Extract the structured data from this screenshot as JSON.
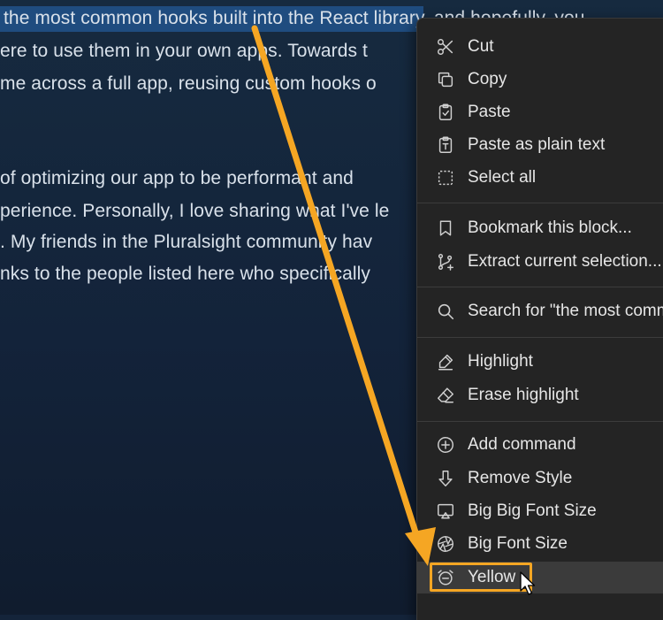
{
  "document": {
    "lines": [
      " the most common hooks built into the React library, and hopefully, you",
      "ere to use them in your own apps. Towards t",
      "me across a full app, reusing custom hooks o",
      "of optimizing our app to be performant and",
      "perience. Personally, I love sharing what I've le",
      ". My friends in the Pluralsight community hav",
      "nks to the people listed here who specifically"
    ],
    "highlighted_text": " the most common hooks built into the React library"
  },
  "context_menu": {
    "items": [
      {
        "label": "Cut",
        "icon": "scissors-icon"
      },
      {
        "label": "Copy",
        "icon": "copy-icon"
      },
      {
        "label": "Paste",
        "icon": "clipboard-check-icon"
      },
      {
        "label": "Paste as plain text",
        "icon": "clipboard-text-icon"
      },
      {
        "label": "Select all",
        "icon": "select-all-icon"
      },
      {
        "label": "Bookmark this block...",
        "icon": "bookmark-icon"
      },
      {
        "label": "Extract current selection...",
        "icon": "branch-plus-icon"
      },
      {
        "label": "Search for \"the most comm",
        "icon": "search-icon"
      },
      {
        "label": "Highlight",
        "icon": "highlighter-icon"
      },
      {
        "label": "Erase highlight",
        "icon": "eraser-icon"
      },
      {
        "label": "Add command",
        "icon": "plus-circle-icon"
      },
      {
        "label": "Remove Style",
        "icon": "arrow-down-icon"
      },
      {
        "label": "Big Big Font Size",
        "icon": "screen-share-icon"
      },
      {
        "label": "Big Font Size",
        "icon": "aperture-icon"
      },
      {
        "label": "Yellow",
        "icon": "alarm-minus-icon"
      }
    ],
    "active_item": "Yellow"
  },
  "colors": {
    "background": "#14243a",
    "selection": "#1f4c7f",
    "menu_background": "#242424",
    "annotation": "#f5a623"
  }
}
